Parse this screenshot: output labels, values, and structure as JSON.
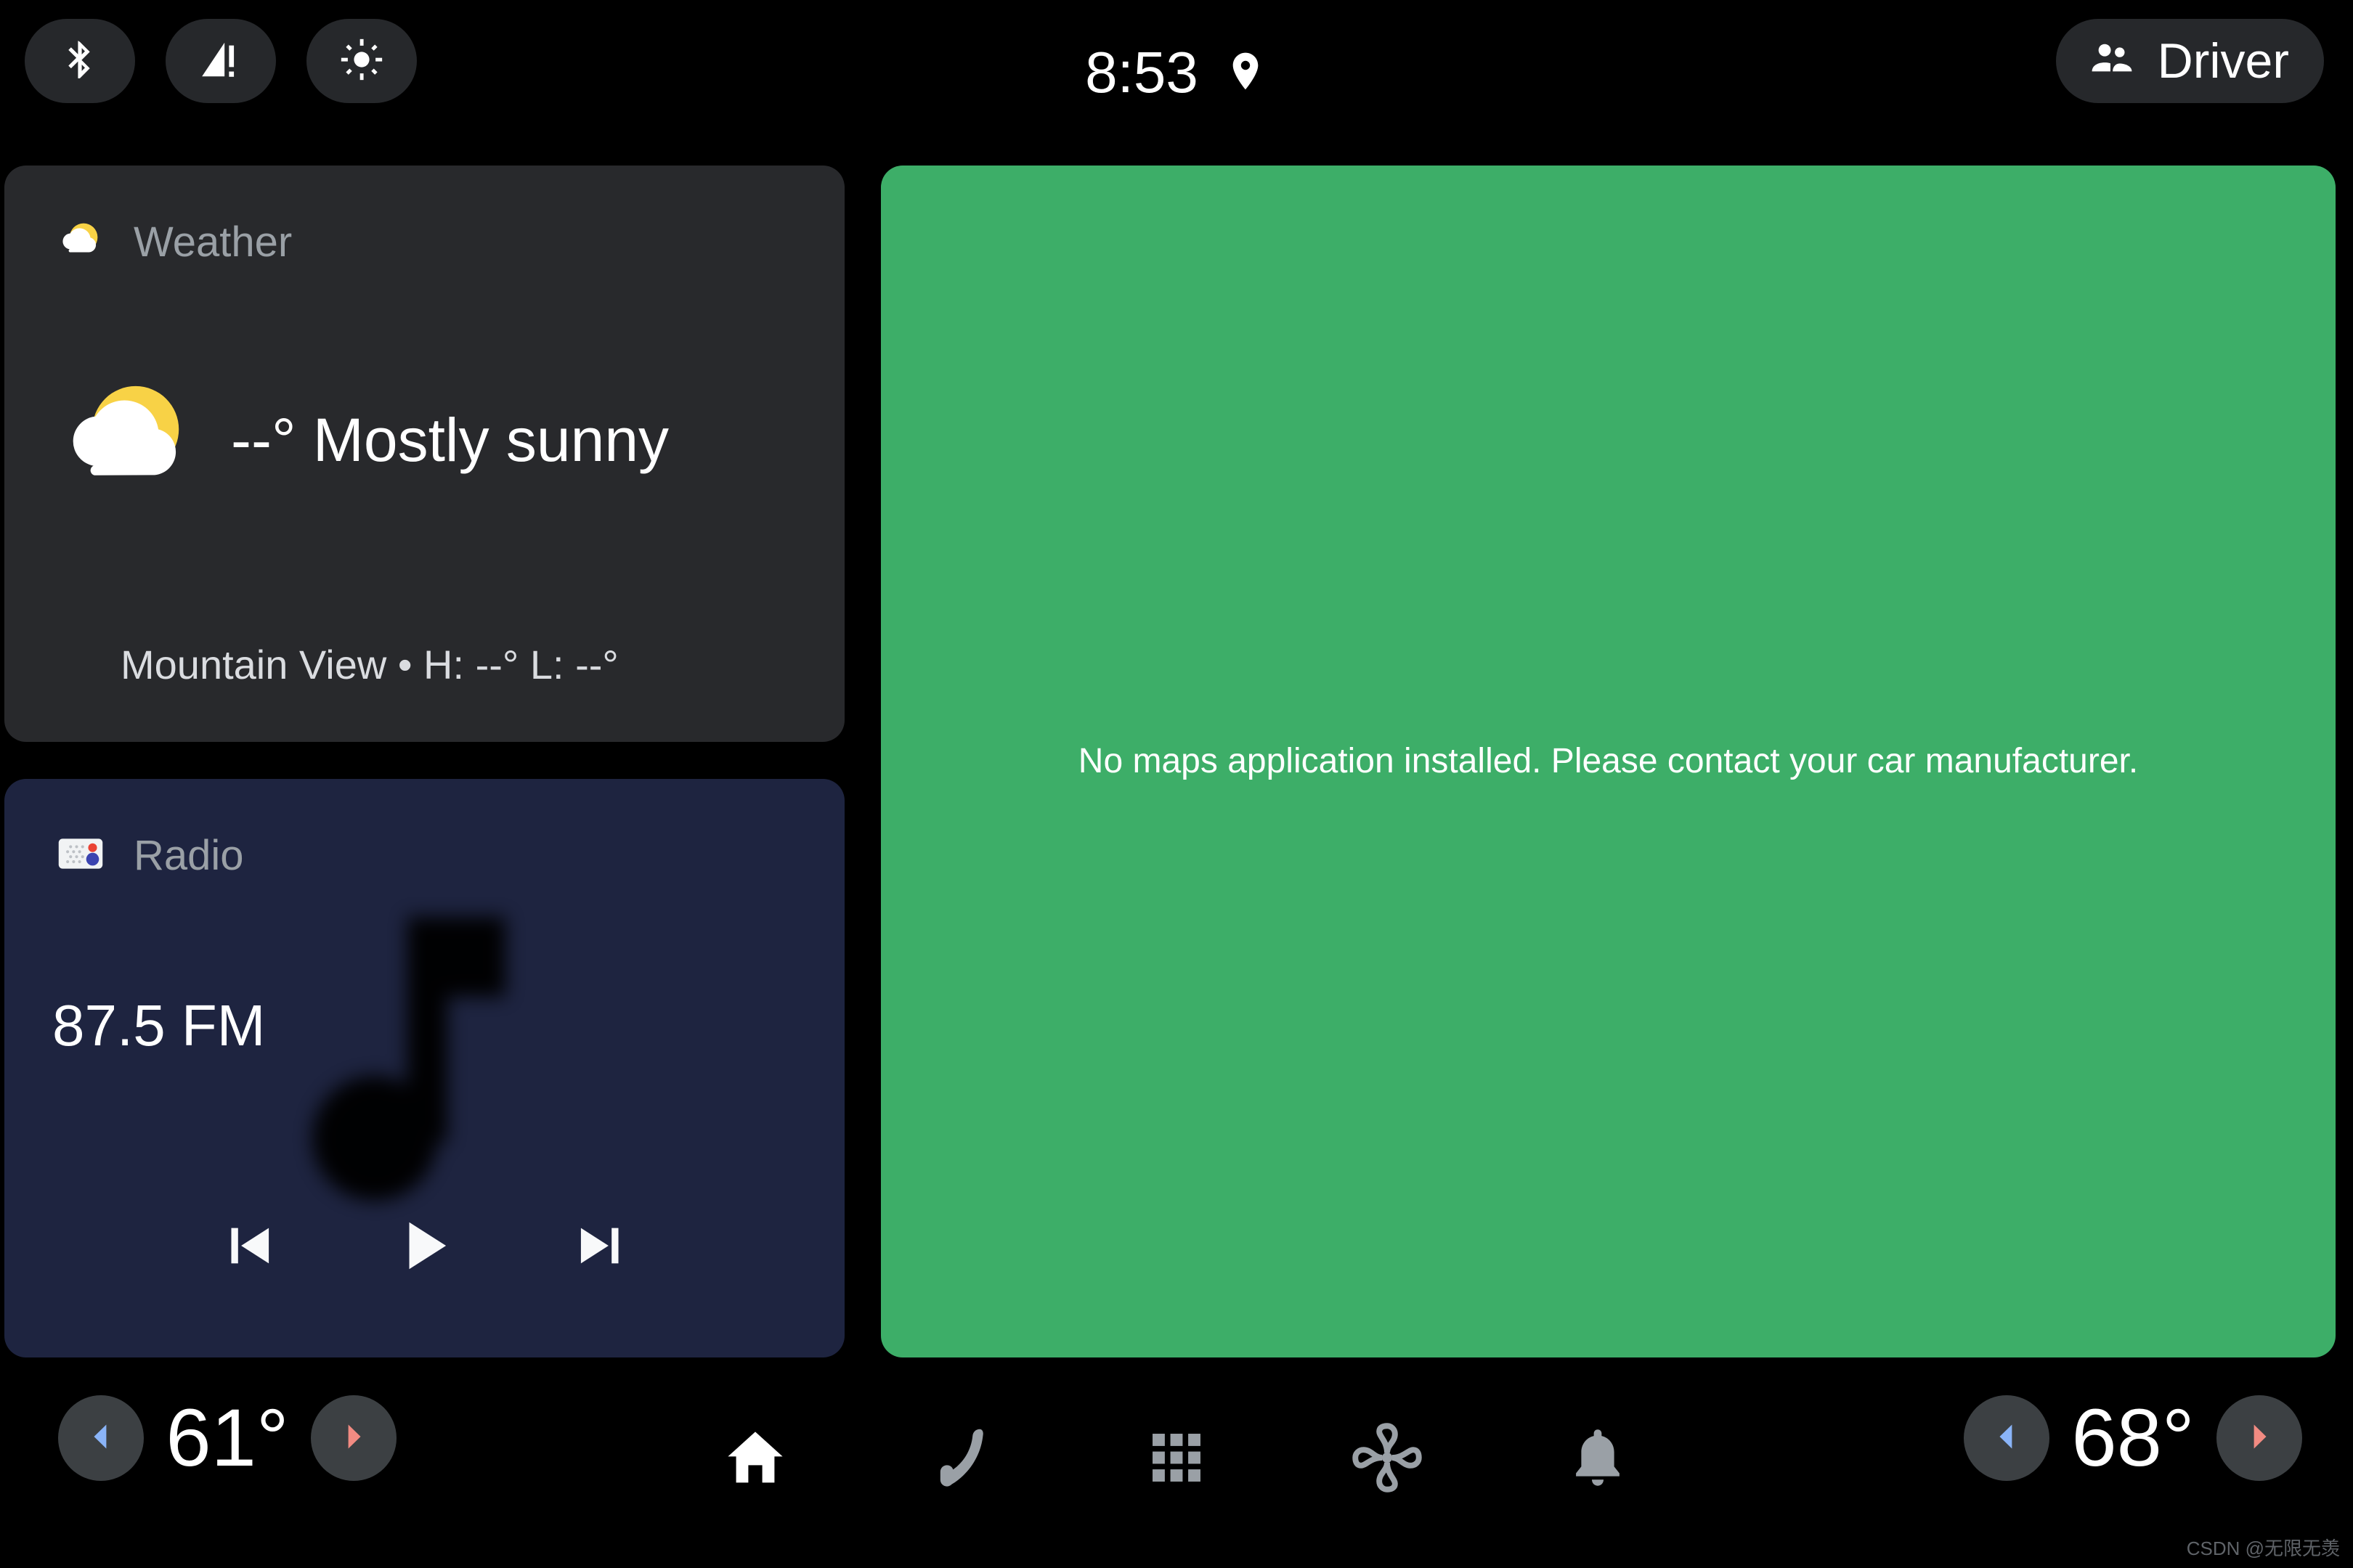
{
  "statusbar": {
    "icons": [
      {
        "name": "bluetooth-icon",
        "label": "Bluetooth"
      },
      {
        "name": "cellular-alert-icon",
        "label": "No cellular service"
      },
      {
        "name": "brightness-icon",
        "label": "Brightness"
      }
    ],
    "clock": "8:53",
    "location_icon": "location-pin-icon",
    "driver": {
      "label": "Driver",
      "icon": "people-icon"
    }
  },
  "weather_card": {
    "header_label": "Weather",
    "header_icon": "partly-sunny-icon",
    "condition_icon": "partly-sunny-icon",
    "condition_text": "--° Mostly sunny",
    "footer_text": "Mountain View • H: --° L: --°",
    "background_color": "#28292C"
  },
  "radio_card": {
    "header_label": "Radio",
    "header_icon": "radio-app-icon",
    "frequency": "87.5 FM",
    "background_color": "#1E2440",
    "controls": [
      {
        "name": "skip-previous-button",
        "label": "Previous"
      },
      {
        "name": "play-button",
        "label": "Play"
      },
      {
        "name": "skip-next-button",
        "label": "Next"
      }
    ]
  },
  "map_panel": {
    "message": "No maps application installed. Please contact your car manufacturer.",
    "background_color": "#3DAE68"
  },
  "navbar": {
    "driver_temp": {
      "value": "61°",
      "decrease_label": "Decrease driver temperature",
      "increase_label": "Increase driver temperature"
    },
    "passenger_temp": {
      "value": "68°",
      "decrease_label": "Decrease passenger temperature",
      "increase_label": "Increase passenger temperature"
    },
    "items": [
      {
        "name": "nav-home",
        "label": "Home",
        "icon": "home-icon",
        "active": true
      },
      {
        "name": "nav-phone",
        "label": "Phone",
        "icon": "phone-icon",
        "active": false
      },
      {
        "name": "nav-apps",
        "label": "Apps",
        "icon": "grid-apps-icon",
        "active": false
      },
      {
        "name": "nav-climate",
        "label": "Climate",
        "icon": "fan-icon",
        "active": false
      },
      {
        "name": "nav-notifications",
        "label": "Notifications",
        "icon": "bell-icon",
        "active": false
      }
    ],
    "accent_cold": "#8AB4F8",
    "accent_hot": "#F28B82"
  },
  "watermark": "CSDN @无限无羡"
}
